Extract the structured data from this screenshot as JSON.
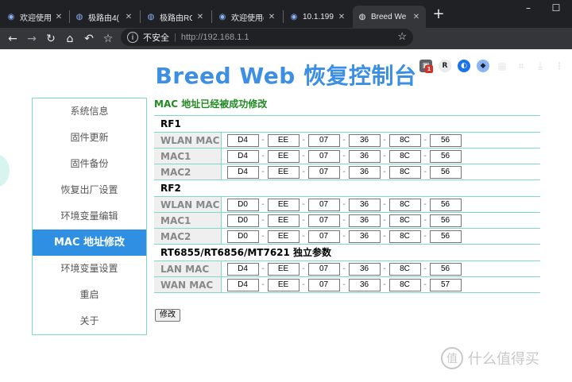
{
  "browser": {
    "tabs": [
      {
        "label": "欢迎使用(",
        "icon": "router-icon",
        "active": false
      },
      {
        "label": "极路由4(",
        "icon": "globe-icon",
        "active": false
      },
      {
        "label": "极路由RO",
        "icon": "globe-icon",
        "active": false
      },
      {
        "label": "欢迎使用(",
        "icon": "router-icon",
        "active": false
      },
      {
        "label": "10.1.199.",
        "icon": "router-icon",
        "active": false
      },
      {
        "label": "Breed We",
        "icon": "globe-icon",
        "active": true
      }
    ],
    "omnibox": {
      "security_label": "不安全",
      "separator": "|",
      "url": "http://192.168.1.1"
    },
    "icons": [
      "back-icon",
      "forward-icon",
      "reload-icon",
      "home-icon",
      "undo-icon",
      "bookmark-star-icon"
    ],
    "extension_badge": "1"
  },
  "page": {
    "title": "Breed Web 恢复控制台",
    "sidebar": [
      {
        "label": "系统信息",
        "active": false
      },
      {
        "label": "固件更新",
        "active": false
      },
      {
        "label": "固件备份",
        "active": false
      },
      {
        "label": "恢复出厂设置",
        "active": false
      },
      {
        "label": "环境变量编辑",
        "active": false
      },
      {
        "label": "MAC 地址修改",
        "active": true
      },
      {
        "label": "环境变量设置",
        "active": false
      },
      {
        "label": "重启",
        "active": false
      },
      {
        "label": "关于",
        "active": false
      }
    ],
    "message": "MAC 地址已经被成功修改",
    "sections": [
      {
        "title": "RF1",
        "rows": [
          {
            "label": "WLAN MAC",
            "octets": [
              "D4",
              "EE",
              "07",
              "36",
              "8C",
              "56"
            ]
          },
          {
            "label": "MAC1",
            "octets": [
              "D4",
              "EE",
              "07",
              "36",
              "8C",
              "56"
            ]
          },
          {
            "label": "MAC2",
            "octets": [
              "D4",
              "EE",
              "07",
              "36",
              "8C",
              "56"
            ]
          }
        ]
      },
      {
        "title": "RF2",
        "rows": [
          {
            "label": "WLAN MAC",
            "octets": [
              "D0",
              "EE",
              "07",
              "36",
              "8C",
              "56"
            ]
          },
          {
            "label": "MAC1",
            "octets": [
              "D0",
              "EE",
              "07",
              "36",
              "8C",
              "56"
            ]
          },
          {
            "label": "MAC2",
            "octets": [
              "D0",
              "EE",
              "07",
              "36",
              "8C",
              "56"
            ]
          }
        ]
      },
      {
        "title": "RT6855/RT6856/MT7621 独立参数",
        "rows": [
          {
            "label": "LAN MAC",
            "octets": [
              "D4",
              "EE",
              "07",
              "36",
              "8C",
              "56"
            ]
          },
          {
            "label": "WAN MAC",
            "octets": [
              "D4",
              "EE",
              "07",
              "36",
              "8C",
              "57"
            ]
          }
        ]
      }
    ],
    "separator": "-",
    "modify_button": "修改",
    "watermark": "什么值得买",
    "watermark_logo": "值"
  },
  "colors": {
    "title": "#3d8fe3",
    "active_menu": "#2f8fe3",
    "border": "#7fd9c6",
    "success": "#1f8a1f"
  }
}
